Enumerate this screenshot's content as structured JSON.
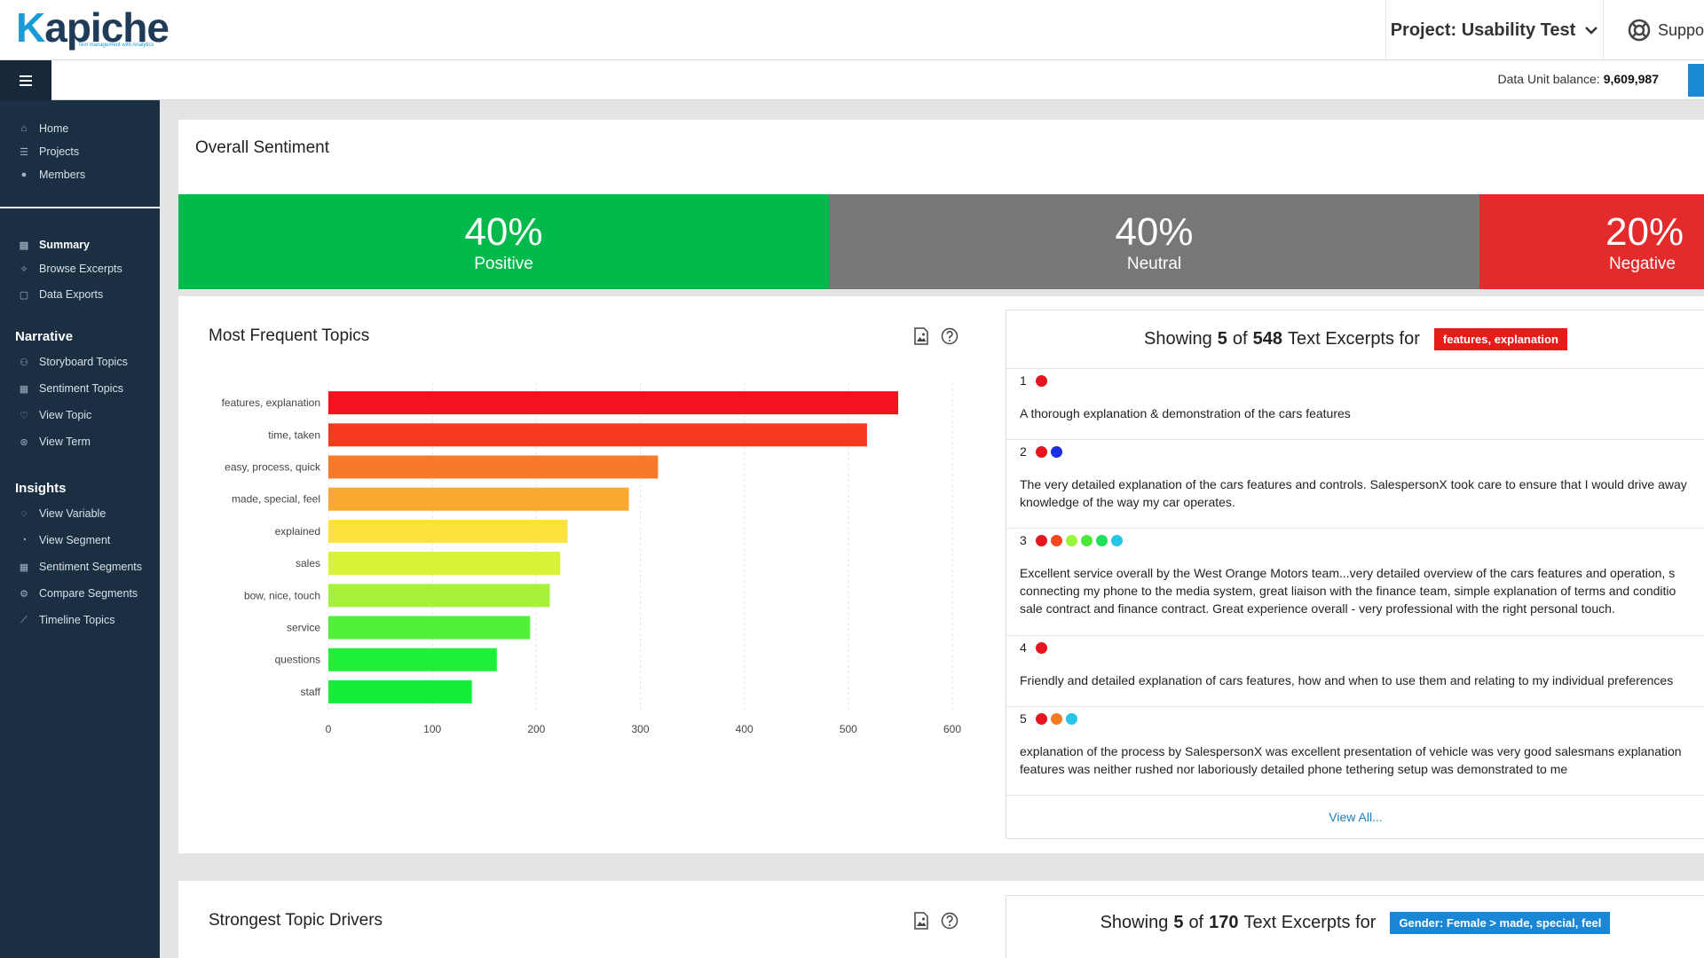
{
  "header": {
    "logo_text": "Kapiche",
    "logo_tagline": "Text management with Analytics",
    "project_label": "Project: Usability Test",
    "support_label": "Support"
  },
  "subbar": {
    "balance_label": "Data Unit balance:",
    "balance_value": "9,609,987"
  },
  "sidebar": {
    "main_items": [
      {
        "label": "Home",
        "icon": "home-icon"
      },
      {
        "label": "Projects",
        "icon": "projects-icon"
      },
      {
        "label": "Members",
        "icon": "user-icon"
      }
    ],
    "project_items": [
      {
        "label": "Summary",
        "icon": "summary-icon",
        "active": true
      },
      {
        "label": "Browse Excerpts",
        "icon": "browse-icon"
      },
      {
        "label": "Data Exports",
        "icon": "document-icon"
      }
    ],
    "narrative_heading": "Narrative",
    "narrative_items": [
      {
        "label": "Storyboard Topics",
        "icon": "storyboard-icon"
      },
      {
        "label": "Sentiment Topics",
        "icon": "sentiment-icon"
      },
      {
        "label": "View Topic",
        "icon": "heart-icon"
      },
      {
        "label": "View Term",
        "icon": "term-icon"
      }
    ],
    "insights_heading": "Insights",
    "insights_items": [
      {
        "label": "View Variable",
        "icon": "variable-icon"
      },
      {
        "label": "View Segment",
        "icon": "segment-icon"
      },
      {
        "label": "Sentiment Segments",
        "icon": "sentiment-segments-icon"
      },
      {
        "label": "Compare Segments",
        "icon": "compare-icon"
      },
      {
        "label": "Timeline Topics",
        "icon": "timeline-icon"
      }
    ]
  },
  "sentiment": {
    "title": "Overall Sentiment",
    "segments": [
      {
        "pct": "40%",
        "label": "Positive",
        "color": "#02b94b"
      },
      {
        "pct": "40%",
        "label": "Neutral",
        "color": "#777777"
      },
      {
        "pct": "20%",
        "label": "Negative",
        "color": "#e42a2a"
      }
    ]
  },
  "topics": {
    "title": "Most Frequent Topics"
  },
  "chart_data": {
    "type": "bar",
    "orientation": "horizontal",
    "categories": [
      "features, explanation",
      "time, taken",
      "easy, process, quick",
      "made, special, feel",
      "explained",
      "sales",
      "bow, nice, touch",
      "service",
      "questions",
      "staff"
    ],
    "values": [
      548,
      518,
      317,
      289,
      230,
      223,
      213,
      194,
      162,
      138
    ],
    "colors": [
      "#f5121f",
      "#f53a1f",
      "#f77a2a",
      "#f9a832",
      "#fbe33b",
      "#d9f238",
      "#a6f23a",
      "#52ef3a",
      "#20ef3a",
      "#12ee3a"
    ],
    "xlim": [
      0,
      600
    ],
    "xticks": [
      0,
      100,
      200,
      300,
      400,
      500,
      600
    ],
    "grid": true
  },
  "excerpts": {
    "prefix": "Showing",
    "shown": "5",
    "of": "of",
    "total": "548",
    "suffix": "Text Excerpts for",
    "tag": "features, explanation",
    "tag_color": "#e81b1b",
    "items": [
      {
        "num": "1",
        "dots": [
          "#e8141e"
        ],
        "lines": [
          "A thorough explanation & demonstration of the cars features"
        ]
      },
      {
        "num": "2",
        "dots": [
          "#e8141e",
          "#1a2ee8"
        ],
        "lines": [
          "The very detailed explanation of the cars features and controls. SalespersonX took care to ensure that I would drive away",
          "knowledge of the way my car operates."
        ]
      },
      {
        "num": "3",
        "dots": [
          "#e8141e",
          "#f5461f",
          "#9af53a",
          "#4be83a",
          "#1fe05a",
          "#26c6e8"
        ],
        "lines": [
          "Excellent service overall by the West Orange Motors team...very detailed overview of the cars features and operation, s",
          "connecting my phone to the media system, great liaison with the finance team, simple explanation of terms and conditio",
          "sale contract and finance contract. Great experience overall - very professional with the right personal touch."
        ]
      },
      {
        "num": "4",
        "dots": [
          "#e8141e"
        ],
        "lines": [
          "Friendly and detailed explanation of cars features, how and when to use them and relating to my individual preferences"
        ]
      },
      {
        "num": "5",
        "dots": [
          "#e8141e",
          "#f57a1f",
          "#26c6e8"
        ],
        "lines": [
          "explanation of the process by SalespersonX was excellent presentation of vehicle was very good salesmans explanation",
          "features was neither rushed nor laboriously detailed phone tethering setup was demonstrated to me"
        ]
      }
    ],
    "view_all": "View All..."
  },
  "drivers": {
    "title": "Strongest Topic Drivers",
    "prefix": "Showing",
    "shown": "5",
    "of": "of",
    "total": "170",
    "suffix": "Text Excerpts for",
    "tag": "Gender: Female > made, special, feel",
    "tag_color": "#1a87d6"
  }
}
